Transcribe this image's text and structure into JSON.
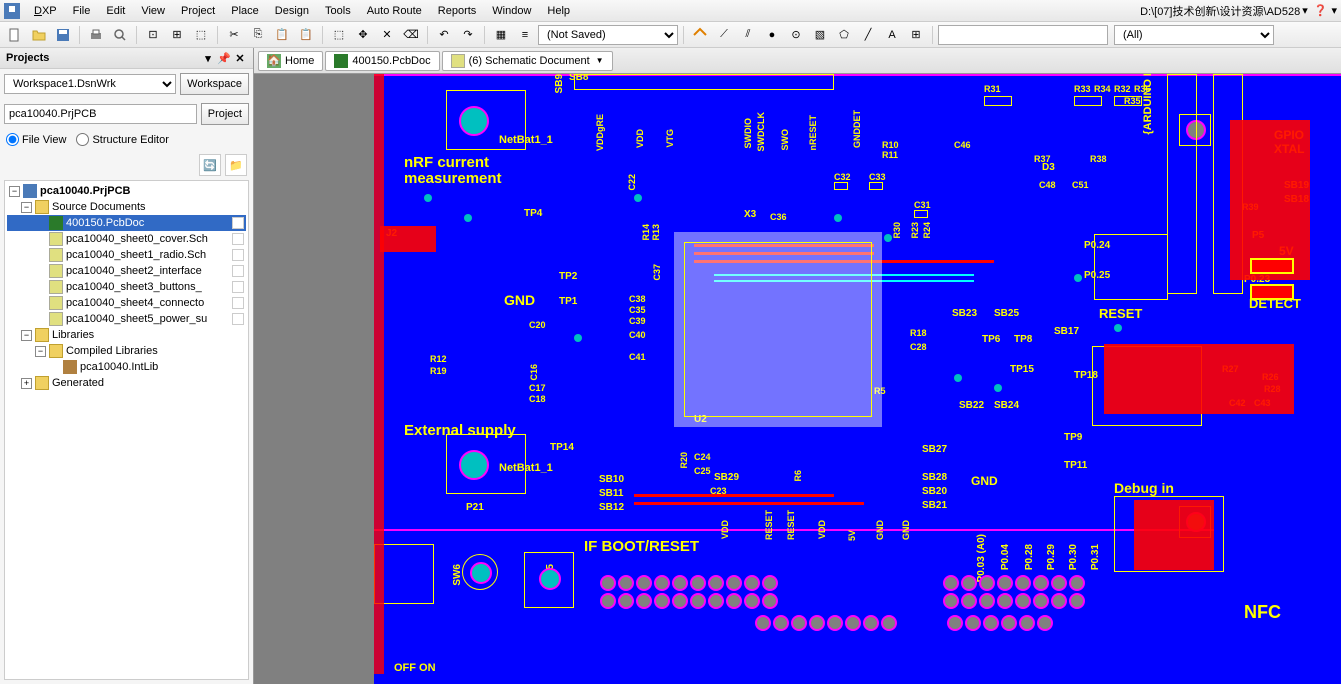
{
  "menu": {
    "items": [
      "DXP",
      "File",
      "Edit",
      "View",
      "Project",
      "Place",
      "Design",
      "Tools",
      "Auto Route",
      "Reports",
      "Window",
      "Help"
    ]
  },
  "breadcrumb": "D:\\[07]技术创新\\设计资源\\AD528",
  "toolbar": {
    "notsaved": "(Not Saved)",
    "all": "(All)"
  },
  "panel": {
    "title": "Projects",
    "workspace": "Workspace1.DsnWrk",
    "workspace_btn": "Workspace",
    "project": "pca10040.PrjPCB",
    "project_btn": "Project",
    "view_file": "File View",
    "view_struct": "Structure Editor"
  },
  "tree": {
    "root": "pca10040.PrjPCB",
    "src": "Source Documents",
    "pcb": "400150.PcbDoc",
    "s0": "pca10040_sheet0_cover.Sch",
    "s1": "pca10040_sheet1_radio.Sch",
    "s2": "pca10040_sheet2_interface",
    "s3": "pca10040_sheet3_buttons_",
    "s4": "pca10040_sheet4_connecto",
    "s5": "pca10040_sheet5_power_su",
    "lib": "Libraries",
    "clib": "Compiled Libraries",
    "intlib": "pca10040.IntLib",
    "gen": "Generated"
  },
  "tabs": {
    "home": "Home",
    "doc": "400150.PcbDoc",
    "sch": "(6) Schematic Document"
  },
  "silk": {
    "nrf": "nRF current",
    "meas": "measurement",
    "ext": "External supply",
    "boot": "IF BOOT/RESET",
    "debug": "Debug in",
    "reset": "RESET",
    "detect": "DETECT",
    "gnd": "GND",
    "nfc": "NFC",
    "gpio": "GPIO",
    "xtal": "XTAL",
    "fivev": "5V",
    "netbat1": "NetBat1_1",
    "netbat2": "NetBat1_1",
    "offon": "OFF  ON",
    "arduino": "{ARDUINO D"
  },
  "refs": {
    "sb8": "SB8",
    "sb9": "SB9",
    "sb10": "SB10",
    "sb11": "SB11",
    "sb12": "SB12",
    "sb17": "SB17",
    "sb18": "SB18",
    "sb19": "SB19",
    "sb20": "SB20",
    "sb21": "SB21",
    "sb22": "SB22",
    "sb23": "SB23",
    "sb24": "SB24",
    "sb25": "SB25",
    "sb27": "SB27",
    "sb28": "SB28",
    "sb29": "SB29",
    "tp1": "TP1",
    "tp2": "TP2",
    "tp4": "TP4",
    "tp6": "TP6",
    "tp8": "TP8",
    "tp9": "TP9",
    "tp11": "TP11",
    "tp14": "TP14",
    "tp15": "TP15",
    "tp18": "TP18",
    "c16": "C16",
    "c17": "C17",
    "c18": "C18",
    "c20": "C20",
    "c22": "C22",
    "c23": "C23",
    "c24": "C24",
    "c25": "C25",
    "c28": "C28",
    "c31": "C31",
    "c32": "C32",
    "c33": "C33",
    "c35": "C35",
    "c36": "C36",
    "c37": "C37",
    "c38": "C38",
    "c39": "C39",
    "c40": "C40",
    "c41": "C41",
    "c42": "C42",
    "c43": "C43",
    "c46": "C46",
    "c48": "C48",
    "c51": "C51",
    "r5": "R5",
    "r6": "R6",
    "r10": "R10",
    "r11": "R11",
    "r12": "R12",
    "r13": "R13",
    "r14": "R14",
    "r18": "R18",
    "r19": "R19",
    "r20": "R20",
    "r23": "R23",
    "r24": "R24",
    "r26": "R26",
    "r27": "R27",
    "r30": "R30",
    "r31": "R31",
    "r32": "R32",
    "r33": "R33",
    "r34": "R34",
    "r35": "R35",
    "r36": "R36",
    "r37": "R37",
    "r38": "R38",
    "r39": "R39",
    "d3": "D3",
    "u2": "U2",
    "j2": "J2",
    "p21": "P21",
    "x3": "X3",
    "p5": "P5",
    "sw5": "SW5",
    "sw6": "SW6",
    "vdd": "VDD",
    "vtg": "VTG",
    "swo": "SWO",
    "swdclk": "SWDCLK",
    "swdio": "SWDIO",
    "vddgre": "VDDgRE",
    "gnddet": "GNDDET",
    "nreset": "nRESET",
    "p003": "P0.03 (A0)",
    "p004": "P0.04",
    "p023": "P0.23",
    "p024": "P0.24",
    "p025": "P0.25",
    "p028": "P0.28",
    "p029": "P0.29",
    "p030": "P0.30",
    "p031": "P0.31"
  }
}
